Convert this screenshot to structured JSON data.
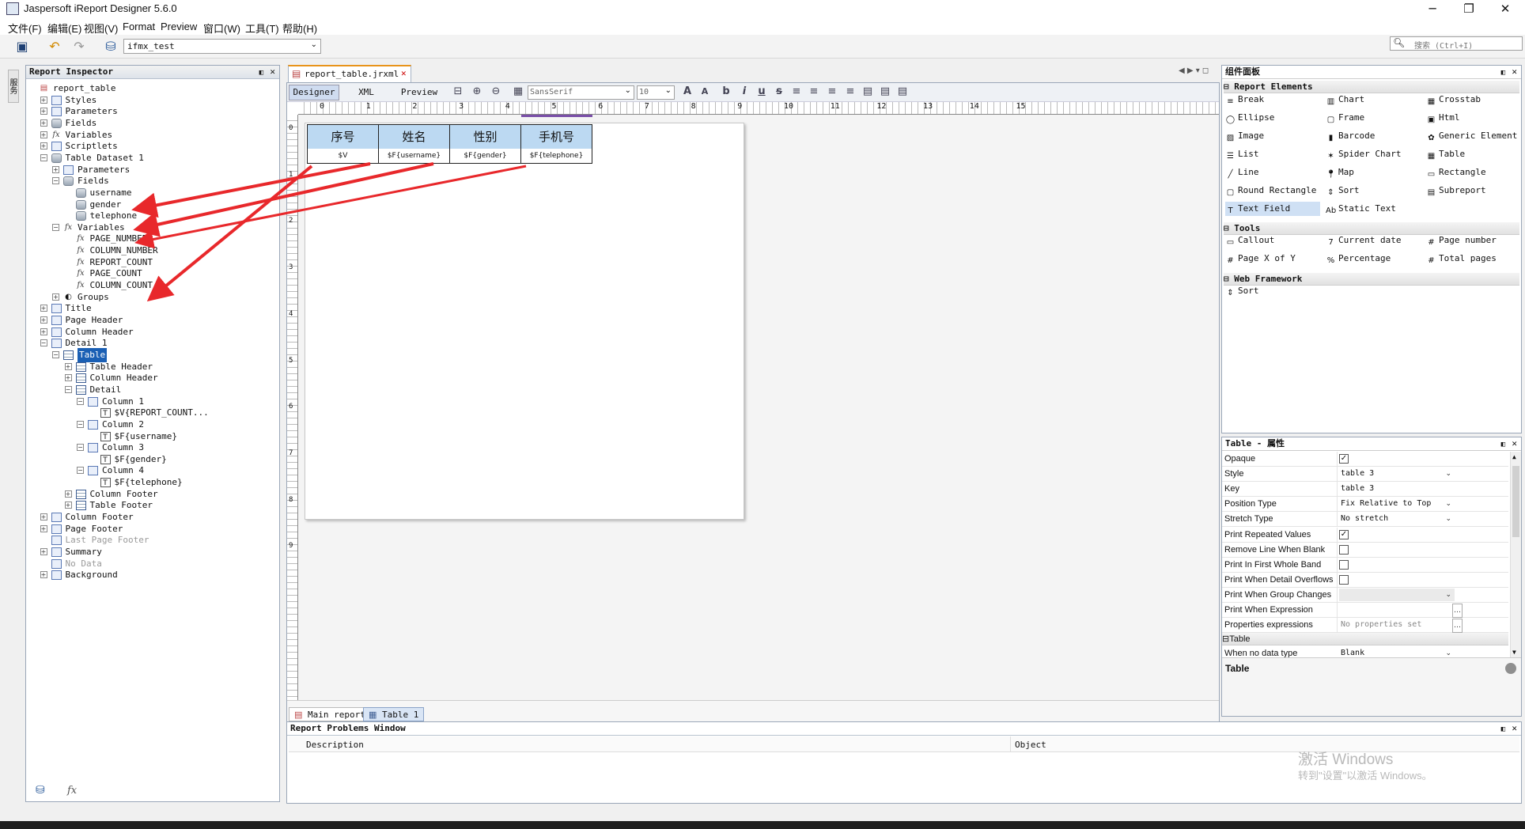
{
  "app": {
    "title": "Jaspersoft iReport Designer 5.6.0"
  },
  "menu": [
    "文件(F)",
    "编辑(E)",
    "视图(V)",
    "Format",
    "Preview",
    "窗口(W)",
    "工具(T)",
    "帮助(H)"
  ],
  "toolbar": {
    "datasource": "ifmx_test",
    "search_placeholder": "搜索 (Ctrl+I)"
  },
  "inspector": {
    "title": "Report Inspector",
    "root": "report_table",
    "nodes": {
      "styles": "Styles",
      "parameters": "Parameters",
      "fields": "Fields",
      "variables": "Variables",
      "scriptlets": "Scriptlets",
      "dataset": "Table Dataset 1",
      "ds_parameters": "Parameters",
      "ds_fields": "Fields",
      "f_username": "username",
      "f_gender": "gender",
      "f_telephone": "telephone",
      "ds_variables": "Variables",
      "v_page_number": "PAGE_NUMBER",
      "v_column_number": "COLUMN_NUMBER",
      "v_report_count": "REPORT_COUNT",
      "v_page_count": "PAGE_COUNT",
      "v_column_count": "COLUMN_COUNT",
      "groups": "Groups",
      "title": "Title",
      "page_header": "Page Header",
      "column_header": "Column Header",
      "detail1": "Detail 1",
      "table": "Table",
      "table_header": "Table Header",
      "tbl_column_header": "Column Header",
      "detail": "Detail",
      "col1": "Column 1",
      "col1_tf": "$V{REPORT_COUNT...",
      "col2": "Column 2",
      "col2_tf": "$F{username}",
      "col3": "Column 3",
      "col3_tf": "$F{gender}",
      "col4": "Column 4",
      "col4_tf": "$F{telephone}",
      "tbl_column_footer": "Column Footer",
      "table_footer": "Table Footer",
      "column_footer": "Column Footer",
      "page_footer": "Page Footer",
      "last_page_footer": "Last Page Footer",
      "summary": "Summary",
      "no_data": "No Data",
      "background": "Background"
    }
  },
  "editor": {
    "file_tab": "report_table.jrxml",
    "view_tabs": [
      "Designer",
      "XML",
      "Preview"
    ],
    "font": "SansSerif",
    "font_size": "10",
    "ruler_h": [
      "0",
      "1",
      "2",
      "3",
      "4",
      "5",
      "6",
      "7",
      "8",
      "9",
      "10",
      "11",
      "12",
      "13",
      "14",
      "15"
    ],
    "ruler_v": [
      "0",
      "1",
      "2",
      "3",
      "4",
      "5",
      "6",
      "7",
      "8",
      "9"
    ],
    "table_headers": [
      "序号",
      "姓名",
      "性别",
      "手机号"
    ],
    "table_cells": [
      "$V",
      "$F{username}",
      "$F{gender}",
      "$F{telephone}"
    ],
    "bottom_tabs": [
      "Main report",
      "Table 1"
    ]
  },
  "palette": {
    "title": "组件面板",
    "sections": [
      "Report Elements",
      "Tools",
      "Web Framework"
    ],
    "report_elements": [
      "Break",
      "Chart",
      "Crosstab",
      "Ellipse",
      "Frame",
      "Html",
      "Image",
      "Barcode",
      "Generic Element",
      "List",
      "Spider Chart",
      "Table",
      "Line",
      "Map",
      "Rectangle",
      "Round Rectangle",
      "Sort",
      "Subreport",
      "Text Field",
      "Static Text"
    ],
    "tools": [
      "Callout",
      "Current date",
      "Page number",
      "Page X of Y",
      "Percentage",
      "Total pages"
    ],
    "web": [
      "Sort"
    ]
  },
  "properties": {
    "title": "Table - 属性",
    "rows": [
      {
        "name": "Opaque",
        "type": "check",
        "checked": true
      },
      {
        "name": "Style",
        "type": "combo",
        "value": "table 3"
      },
      {
        "name": "Key",
        "type": "text",
        "value": "table 3"
      },
      {
        "name": "Position Type",
        "type": "combo",
        "value": "Fix Relative to Top"
      },
      {
        "name": "Stretch Type",
        "type": "combo",
        "value": "No stretch"
      },
      {
        "name": "Print Repeated Values",
        "type": "check",
        "checked": true
      },
      {
        "name": "Remove Line When Blank",
        "type": "check",
        "checked": false
      },
      {
        "name": "Print In First Whole Band",
        "type": "check",
        "checked": false
      },
      {
        "name": "Print When Detail Overflows",
        "type": "check",
        "checked": false
      },
      {
        "name": "Print When Group Changes",
        "type": "combo",
        "value": ""
      },
      {
        "name": "Print When Expression",
        "type": "dots",
        "value": ""
      },
      {
        "name": "Properties expressions",
        "type": "dots",
        "value": "No properties set"
      }
    ],
    "section": "Table",
    "row_nodata": {
      "name": "When no data type",
      "value": "Blank"
    },
    "desc_title": "Table"
  },
  "problems": {
    "title": "Report Problems Window",
    "col_description": "Description",
    "col_object": "Object"
  },
  "watermark": {
    "line1": "激活 Windows",
    "line2": "转到\"设置\"以激活 Windows。"
  },
  "side_tab": "服务"
}
